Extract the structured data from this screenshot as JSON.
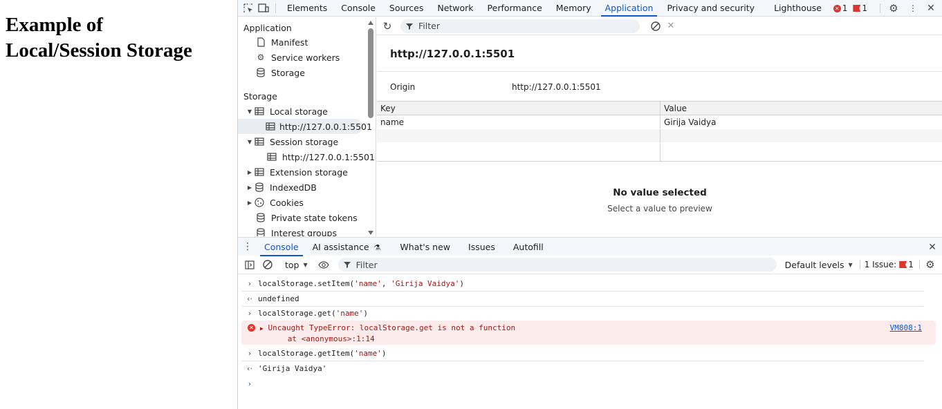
{
  "page": {
    "heading_line1": "Example of",
    "heading_line2": "Local/Session Storage"
  },
  "devtools": {
    "tabs": [
      "Elements",
      "Console",
      "Sources",
      "Network",
      "Performance",
      "Memory",
      "Application",
      "Privacy and security",
      "Lighthouse"
    ],
    "active_tab": "Application",
    "error_count": "1",
    "issue_count": "1"
  },
  "sidebar": {
    "application_heading": "Application",
    "application_items": [
      "Manifest",
      "Service workers",
      "Storage"
    ],
    "storage_heading": "Storage",
    "local_storage": "Local storage",
    "local_origin": "http://127.0.0.1:5501",
    "session_storage": "Session storage",
    "session_origin": "http://127.0.0.1:5501",
    "extension_storage": "Extension storage",
    "indexeddb": "IndexedDB",
    "cookies": "Cookies",
    "private_state_tokens": "Private state tokens",
    "interest_groups": "Interest groups"
  },
  "storage_view": {
    "filter_placeholder": "Filter",
    "title": "http://127.0.0.1:5501",
    "origin_label": "Origin",
    "origin_value": "http://127.0.0.1:5501",
    "columns": [
      "Key",
      "Value"
    ],
    "rows": [
      {
        "key": "name",
        "value": "Girija Vaidya"
      }
    ],
    "no_value_title": "No value selected",
    "no_value_subtitle": "Select a value to preview"
  },
  "drawer": {
    "tabs": [
      "Console",
      "AI assistance",
      "What's new",
      "Issues",
      "Autofill"
    ],
    "active_tab": "Console"
  },
  "console_toolbar": {
    "context": "top",
    "filter_placeholder": "Filter",
    "levels": "Default levels",
    "issues_label": "1 Issue:",
    "issues_count": "1"
  },
  "console": {
    "l1_pre": "localStorage.setItem(",
    "l1_s1": "'name'",
    "l1_mid": ", ",
    "l1_s2": "'Girija Vaidya'",
    "l1_post": ")",
    "l2": "undefined",
    "l3_pre": "localStorage.get(",
    "l3_s1": "'name'",
    "l3_post": ")",
    "err_line1": "Uncaught TypeError: localStorage.get is not a function",
    "err_line2": "    at <anonymous>:1:14",
    "err_link": "VM808:1",
    "l4_pre": "localStorage.getItem(",
    "l4_s1": "'name'",
    "l4_post": ")",
    "l5": "'Girija Vaidya'"
  }
}
